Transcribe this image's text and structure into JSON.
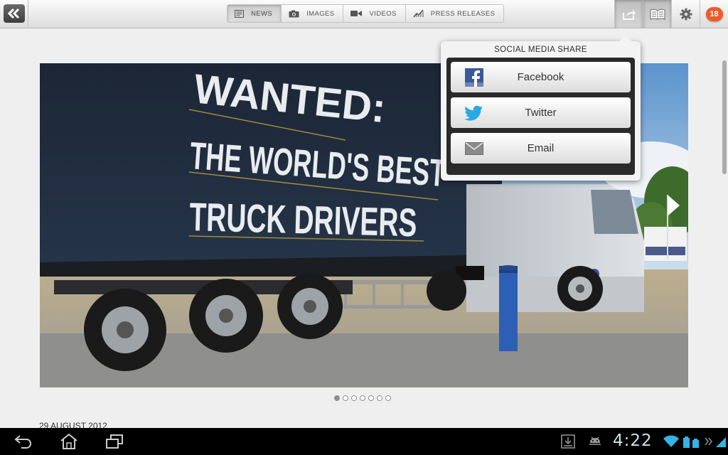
{
  "toolbar": {
    "back_icon": "double-chevron-left-icon",
    "tabs": [
      {
        "label": "NEWS",
        "icon": "newspaper-icon",
        "active": true
      },
      {
        "label": "IMAGES",
        "icon": "camera-icon",
        "active": false
      },
      {
        "label": "VIDEOS",
        "icon": "video-camera-icon",
        "active": false
      },
      {
        "label": "PRESS RELEASES",
        "icon": "chart-icon",
        "active": false
      }
    ],
    "tools": [
      "share-icon",
      "book-icon",
      "gear-icon"
    ],
    "notification_count": "18"
  },
  "hero": {
    "lines": [
      "WANTED:",
      "THE WORLD'S BEST",
      "TRUCK DRIVERS"
    ]
  },
  "carousel": {
    "total": 7,
    "current": 1
  },
  "article": {
    "date": "29 AUGUST 2012"
  },
  "share_popup": {
    "title": "SOCIAL MEDIA SHARE",
    "options": [
      {
        "label": "Facebook",
        "icon": "facebook-icon"
      },
      {
        "label": "Twitter",
        "icon": "twitter-icon"
      },
      {
        "label": "Email",
        "icon": "envelope-icon"
      }
    ]
  },
  "system_bar": {
    "time": "4:22",
    "icons": [
      "back-icon",
      "home-icon",
      "recent-apps-icon",
      "download-icon",
      "android-debug-icon",
      "wifi-icon",
      "battery-icon"
    ]
  },
  "colors": {
    "badge": "#f05a28",
    "clock": "#c8e3f1",
    "twitter": "#2aa9e0",
    "facebook": "#3b5998"
  }
}
